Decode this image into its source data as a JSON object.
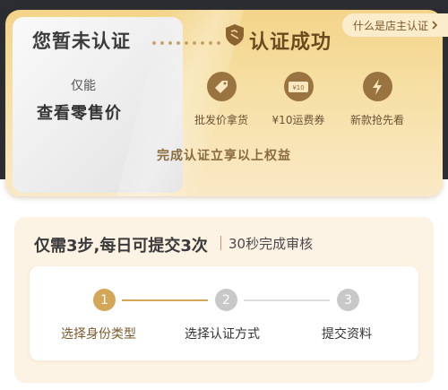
{
  "card": {
    "left_title": "您暂未认证",
    "left_sub1": "仅能",
    "left_sub2": "查看零售价",
    "success_text": "认证成功",
    "shop_btn": "什么是店主认证",
    "shop_btn_icon": "chevron-right-icon",
    "benefits": [
      {
        "icon": "tag-icon",
        "label": "批发价拿货"
      },
      {
        "icon": "coupon-icon",
        "icon_text": "¥10",
        "label": "¥10运费券"
      },
      {
        "icon": "lightning-icon",
        "label": "新款抢先看"
      }
    ],
    "footer": "完成认证立享以上权益"
  },
  "panel": {
    "title": "仅需3步,每日可提交3次",
    "subtitle": "30秒完成审核",
    "steps": [
      {
        "num": "1",
        "label": "选择身份类型",
        "active": true
      },
      {
        "num": "2",
        "label": "选择认证方式",
        "active": false
      },
      {
        "num": "3",
        "label": "提交资料",
        "active": false
      }
    ]
  },
  "colors": {
    "gold": "#f3d489",
    "brown": "#9a7440",
    "active_step": "#d4a658",
    "inactive_step": "#c8c8c8"
  }
}
